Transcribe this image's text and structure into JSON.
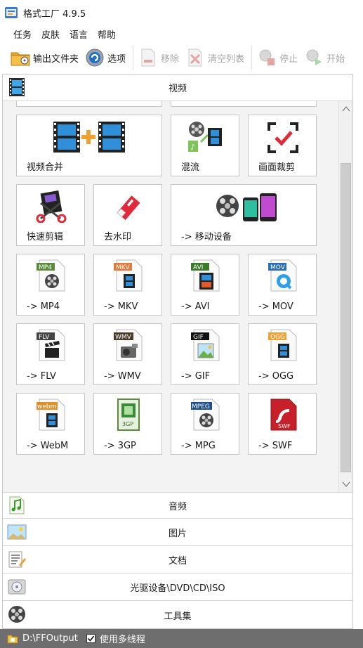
{
  "window": {
    "title": "格式工厂 4.9.5"
  },
  "menu": {
    "items": [
      "任务",
      "皮肤",
      "语言",
      "帮助"
    ]
  },
  "toolbar": {
    "output_folder": "输出文件夹",
    "options": "选项",
    "remove": "移除",
    "clear_list": "清空列表",
    "stop": "停止",
    "start": "开始"
  },
  "categories": {
    "video": "视频",
    "audio": "音频",
    "picture": "图片",
    "document": "文档",
    "disc": "光驱设备\\DVD\\CD\\ISO",
    "tools": "工具集"
  },
  "tiles": {
    "video_merge": "视频合并",
    "mix": "混流",
    "crop": "画面裁剪",
    "quick_clip": "快速剪辑",
    "watermark": "去水印",
    "mobile": "-> 移动设备",
    "mp4": "-> MP4",
    "mkv": "-> MKV",
    "avi": "-> AVI",
    "mov": "-> MOV",
    "flv": "-> FLV",
    "wmv": "-> WMV",
    "gif": "-> GIF",
    "ogg": "-> OGG",
    "webm": "-> WebM",
    "3gp": "-> 3GP",
    "mpg": "-> MPG",
    "swf": "-> SWF"
  },
  "badges": {
    "mp4": "MP4",
    "mkv": "MKV",
    "avi": "AVI",
    "mov": "MOV",
    "flv": "FLV",
    "wmv": "WMV",
    "gif": "GIF",
    "ogg": "OGG",
    "webm": "webm",
    "mpeg": "MPEG",
    "swf": "SWF",
    "3gp": "3GP"
  },
  "status": {
    "output_path": "D:\\FFOutput",
    "multithread_label": "使用多线程",
    "multithread_checked": true
  },
  "colors": {
    "status_bar": "#6e6e6e",
    "accent_orange": "#f0a030",
    "film_blue": "#2a6db5"
  }
}
